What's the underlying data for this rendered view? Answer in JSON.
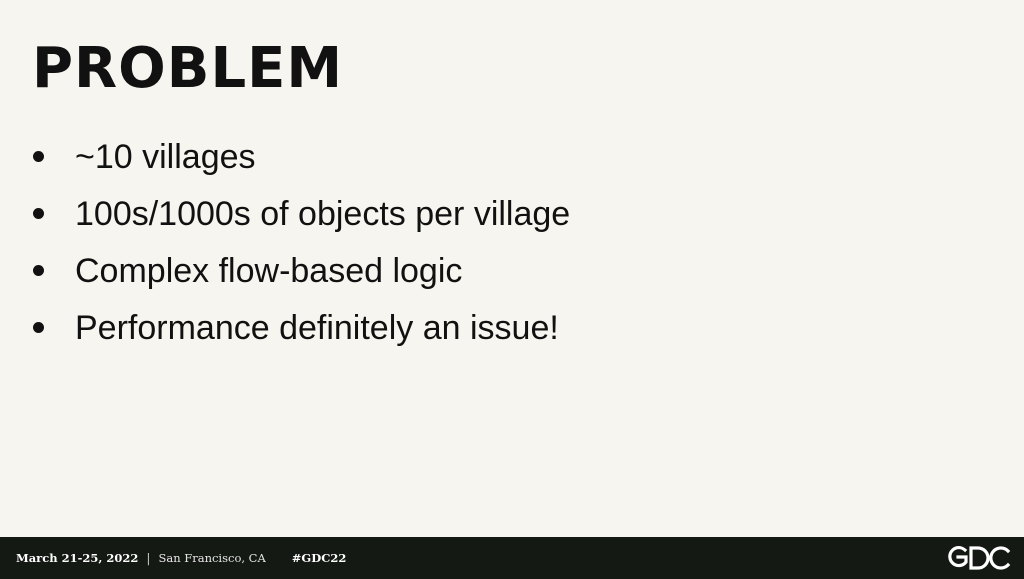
{
  "slide": {
    "title": "PROBLEM",
    "bullets": [
      "~10 villages",
      "100s/1000s of objects per village",
      "Complex flow-based logic",
      "Performance definitely an issue!"
    ]
  },
  "footer": {
    "dates": "March 21-25, 2022",
    "separator": "|",
    "location": "San Francisco, CA",
    "hashtag": "#GDC22",
    "logo_text": "GDC",
    "background_color": "#151914"
  },
  "colors": {
    "background": "#f6f5ef",
    "text": "#111111"
  }
}
